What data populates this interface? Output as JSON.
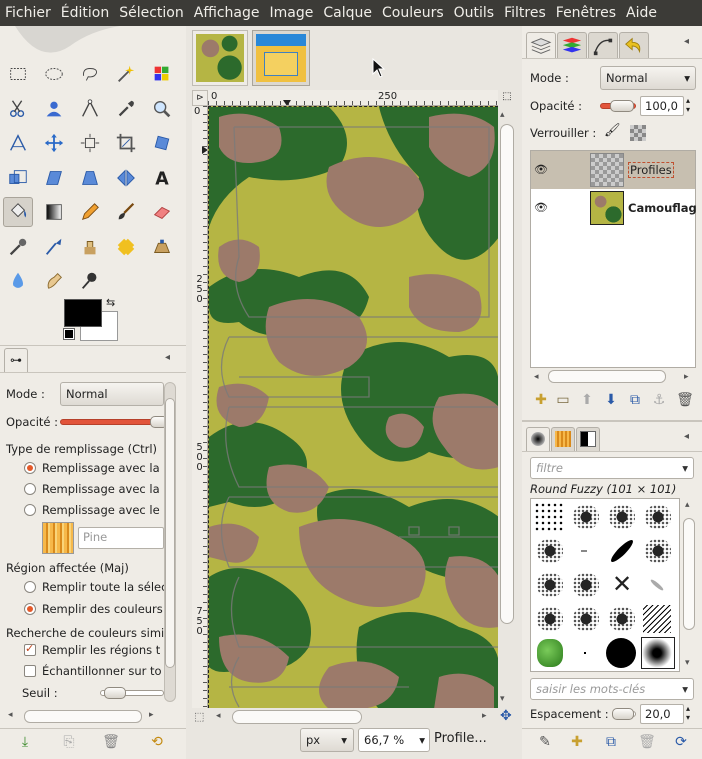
{
  "menubar": {
    "items": [
      "Fichier",
      "Édition",
      "Sélection",
      "Affichage",
      "Image",
      "Calque",
      "Couleurs",
      "Outils",
      "Filtres",
      "Fenêtres",
      "Aide"
    ]
  },
  "toolbox": {
    "tools": [
      "rect-select",
      "ellipse-select",
      "free-select",
      "fuzzy-select",
      "select-by-color",
      "scissors",
      "foreground-select",
      "paths",
      "color-picker",
      "zoom",
      "measure",
      "move",
      "align",
      "crop",
      "rotate",
      "scale",
      "shear",
      "perspective",
      "flip",
      "text",
      "bucket-fill",
      "blend",
      "pencil",
      "paintbrush",
      "eraser",
      "airbrush",
      "ink",
      "clone",
      "heal",
      "perspective-clone",
      "blur",
      "smudge",
      "dodge-burn"
    ],
    "active_tool": "bucket-fill",
    "fg_color": "#000000",
    "bg_color": "#ffffff"
  },
  "tool_options": {
    "mode_label": "Mode :",
    "mode_value": "Normal",
    "opacity_label": "Opacité :",
    "fill_type_title": "Type de remplissage  (Ctrl)",
    "fill_options": [
      "Remplissage avec la",
      "Remplissage avec la",
      "Remplissage avec le"
    ],
    "fill_selected": 0,
    "pattern_name": "Pine",
    "affected_area_title": "Région affectée  (Maj)",
    "area_options": [
      "Remplir toute la sélec",
      "Remplir des couleurs"
    ],
    "area_selected": 1,
    "similar_title": "Recherche de couleurs simi",
    "fill_transparent": "Remplir les régions t",
    "sample_merged": "Échantillonner sur to",
    "fill_transparent_checked": true,
    "sample_merged_checked": false,
    "threshold_label": "Seuil :"
  },
  "canvas": {
    "ruler_top_ticks": [
      "0",
      "250"
    ],
    "ruler_left_ticks": [
      "0",
      "250",
      "500",
      "750"
    ],
    "unit": "px",
    "zoom": "66,7 %",
    "status": "Profile..."
  },
  "layers": {
    "mode_label": "Mode :",
    "mode_value": "Normal",
    "opacity_label": "Opacité :",
    "opacity_value": "100,0",
    "lock_label": "Verrouiller :",
    "items": [
      {
        "name": "Profiles"
      },
      {
        "name": "Camouflag"
      }
    ]
  },
  "brushes": {
    "filter_placeholder": "filtre",
    "brush_title": "Round Fuzzy (101 × 101)",
    "tags_placeholder": "saisir les mots-clés",
    "spacing_label": "Espacement :",
    "spacing_value": "20,0"
  }
}
